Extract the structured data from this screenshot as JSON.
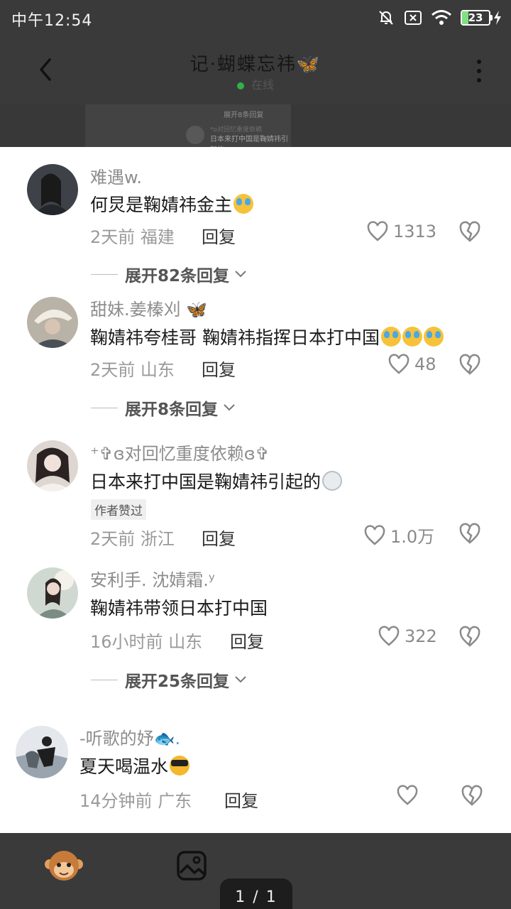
{
  "status_bar": {
    "time": "中午12:54",
    "battery": "23"
  },
  "header": {
    "title": "记·蝴蝶忘祎🦋",
    "subtitle": "在线"
  },
  "peek": {
    "expand_label": "展开8条回复",
    "name": "*o对回忆重度依赖",
    "text": "日本来打中国是鞠婧祎引起的"
  },
  "comments": [
    {
      "name": "难遇w.",
      "text": "何炅是鞠婧祎金主",
      "time": "2天前",
      "location": "福建",
      "reply_label": "回复",
      "likes": "1313",
      "expand": "展开82条回复"
    },
    {
      "name": "甜妹.姜榛刈",
      "text": "鞠婧祎夸桂哥 鞠婧祎指挥日本打中国",
      "time": "2天前",
      "location": "山东",
      "reply_label": "回复",
      "likes": "48",
      "expand": "展开8条回复"
    },
    {
      "name": "⁺✞ɞ对回忆重度依赖ɞ✞",
      "text": "日本来打中国是鞠婧祎引起的",
      "badge": "作者赞过",
      "time": "2天前",
      "location": "浙江",
      "reply_label": "回复",
      "likes": "1.0万"
    },
    {
      "name": "安利手. 沈婧霜.ʸ",
      "text": "鞠婧祎带领日本打中国",
      "time": "16小时前",
      "location": "山东",
      "reply_label": "回复",
      "likes": "322",
      "expand": "展开25条回复"
    },
    {
      "name": "-听歌的妤",
      "text": "夏天喝温水",
      "time": "14分钟前",
      "location": "广东",
      "reply_label": "回复",
      "likes": ""
    }
  ],
  "bottom_bar": {
    "page_indicator": "1 / 1"
  },
  "colors": {
    "background": "#3a3a3a",
    "card": "#ffffff",
    "online": "#2fb14a",
    "battery": "#7fe07f"
  }
}
